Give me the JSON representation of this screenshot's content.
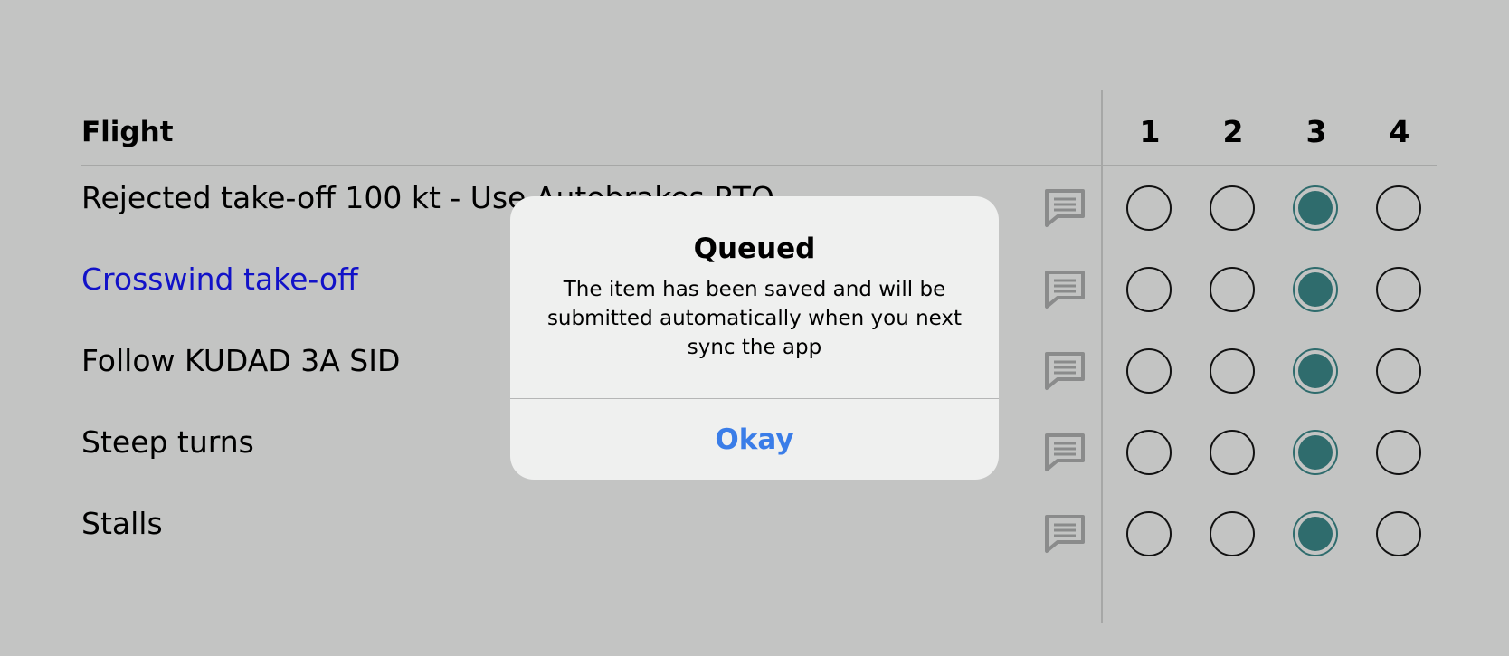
{
  "table": {
    "title": "Flight",
    "columns": [
      "1",
      "2",
      "3",
      "4"
    ],
    "rows": [
      {
        "label": "Rejected take-off 100 kt - Use Autobrakes RTO",
        "selected": 3,
        "link": false
      },
      {
        "label": "Crosswind take-off",
        "selected": 3,
        "link": true
      },
      {
        "label": "Follow KUDAD 3A SID",
        "selected": 3,
        "link": false
      },
      {
        "label": "Steep turns",
        "selected": 3,
        "link": false
      },
      {
        "label": "Stalls",
        "selected": 3,
        "link": false
      }
    ],
    "comment_icon": "comment-icon"
  },
  "dialog": {
    "title": "Queued",
    "message": "The item has been saved and will be submitted automatically when you next sync the app",
    "button": "Okay"
  },
  "colors": {
    "background": "#c3c4c3",
    "selected_radio": "#2f6c6d",
    "link_text": "#1212c8",
    "dialog_background": "#eff0ef",
    "dialog_button": "#3a7de8"
  }
}
